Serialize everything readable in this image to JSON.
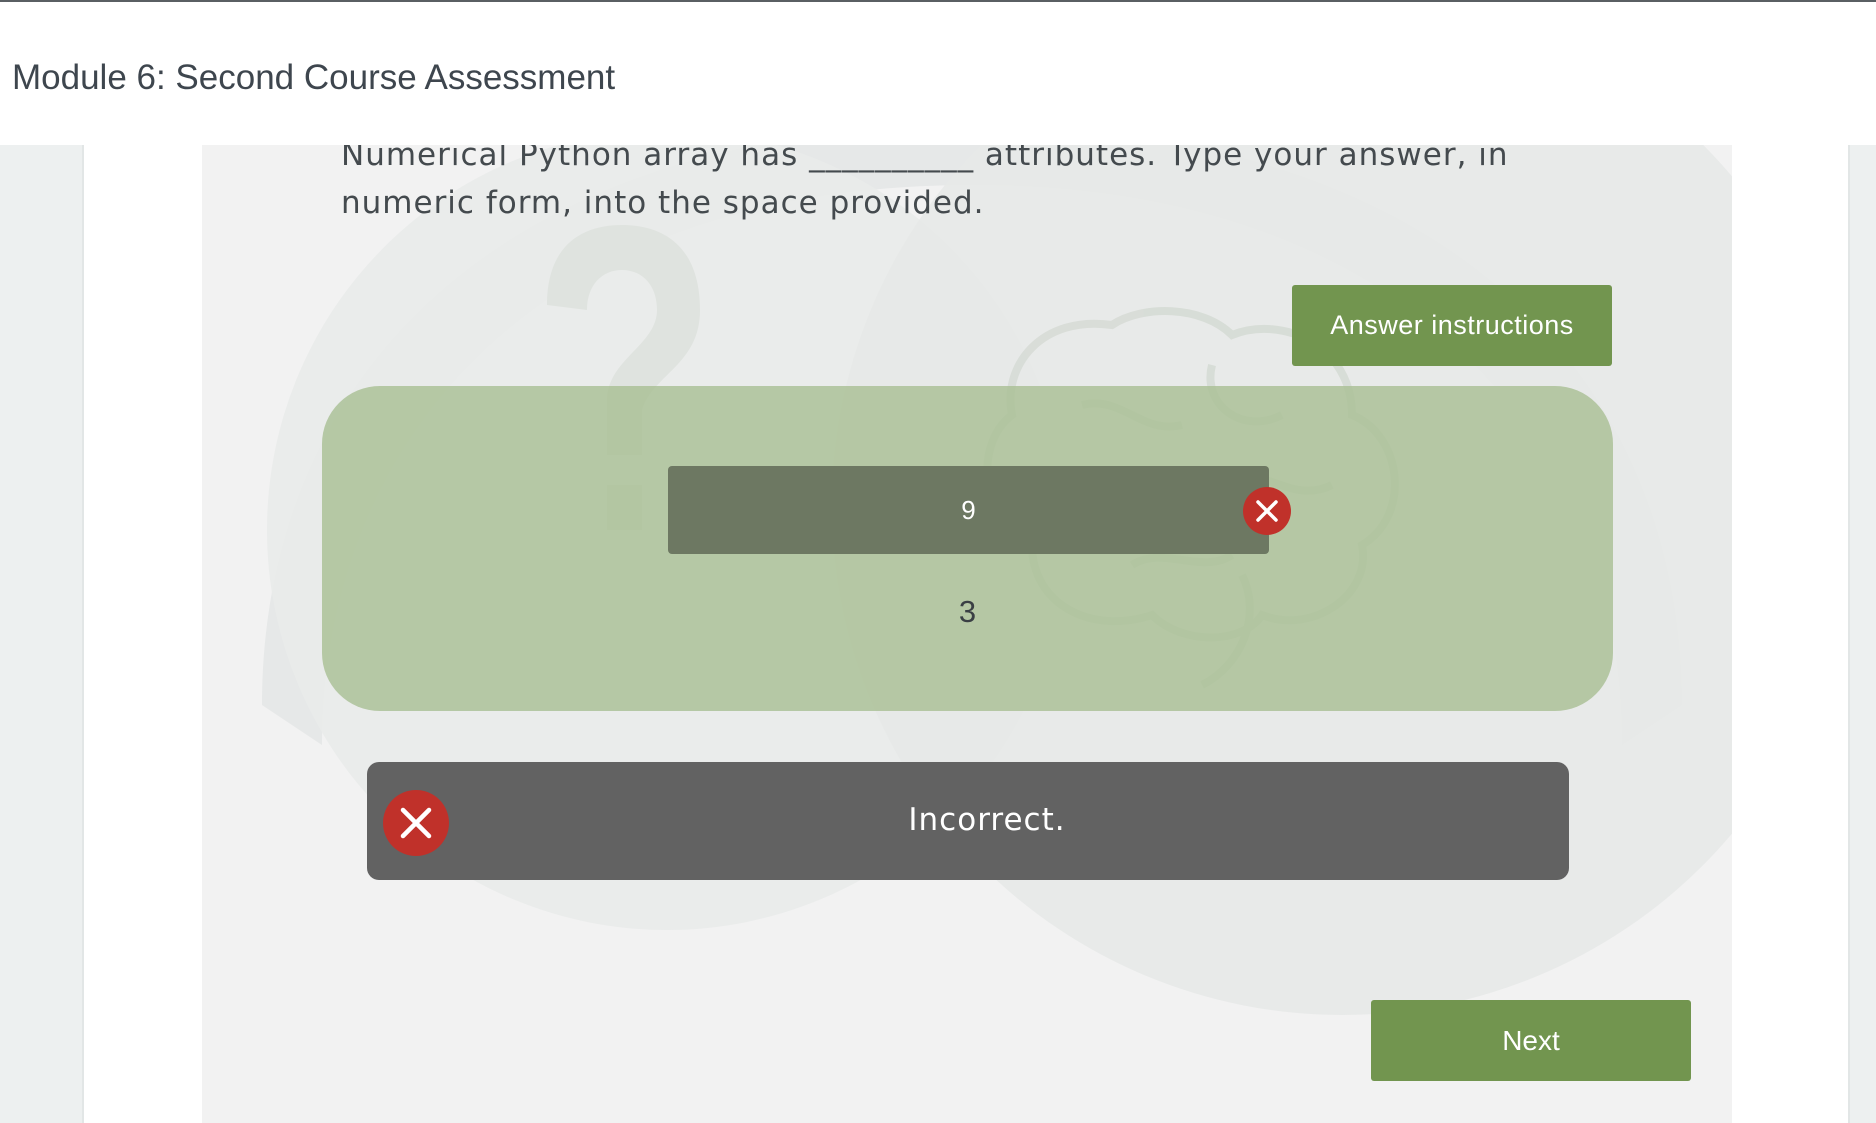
{
  "header": {
    "title": "Module 6: Second Course Assessment"
  },
  "question": {
    "text": "Numerical Python array has __________ attributes. Type your answer, in numeric form, into the space provided."
  },
  "buttons": {
    "answer_instructions_label": "Answer instructions",
    "next_label": "Next"
  },
  "answer": {
    "submitted_value": "9",
    "correct_value": "3",
    "status_icon": "x-circle-icon"
  },
  "feedback": {
    "text": "Incorrect.",
    "icon": "x-circle-icon"
  },
  "colors": {
    "accent_green": "#72954f",
    "incorrect_red": "#c0312a",
    "feedback_gray": "#626262",
    "header_text": "#3e464e"
  }
}
